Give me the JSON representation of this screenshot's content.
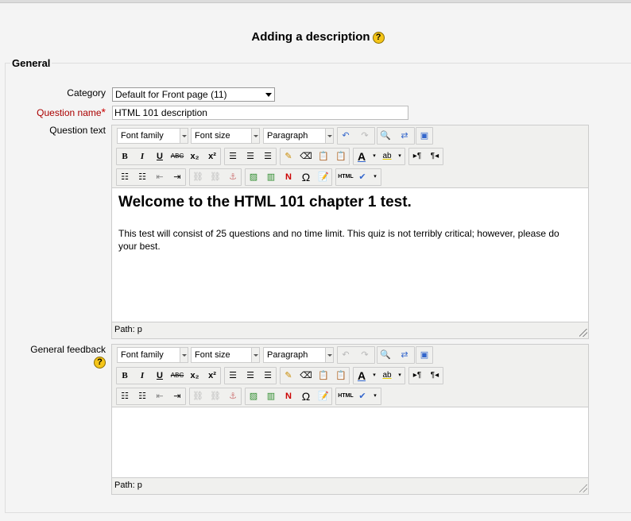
{
  "page": {
    "title": "Adding a description",
    "help_icon": "?"
  },
  "form": {
    "legend": "General",
    "category": {
      "label": "Category",
      "value": "Default for Front page (11)"
    },
    "question_name": {
      "label": "Question name",
      "required_marker": "*",
      "value": "HTML 101 description"
    },
    "question_text": {
      "label": "Question text",
      "heading": "Welcome to the HTML 101 chapter 1 test.",
      "paragraph": "This test will consist of 25 questions and no time limit. This quiz is not terribly critical; however, please do your best.",
      "path": "Path: p"
    },
    "general_feedback": {
      "label": "General feedback",
      "help_icon": "?",
      "path": "Path: p"
    }
  },
  "toolbar": {
    "font_family": "Font family",
    "font_size": "Font size",
    "format": "Paragraph",
    "bold": "B",
    "italic": "I",
    "underline": "U",
    "strike": "ABC",
    "subscript": "x₂",
    "superscript": "x²",
    "omega": "Ω",
    "html": "HTML",
    "font_color": "A",
    "highlight": "ab"
  },
  "colors": {
    "required": "#aa0000",
    "help_icon": "#f5c518",
    "toolbar_bg": "#f0f0ee"
  }
}
